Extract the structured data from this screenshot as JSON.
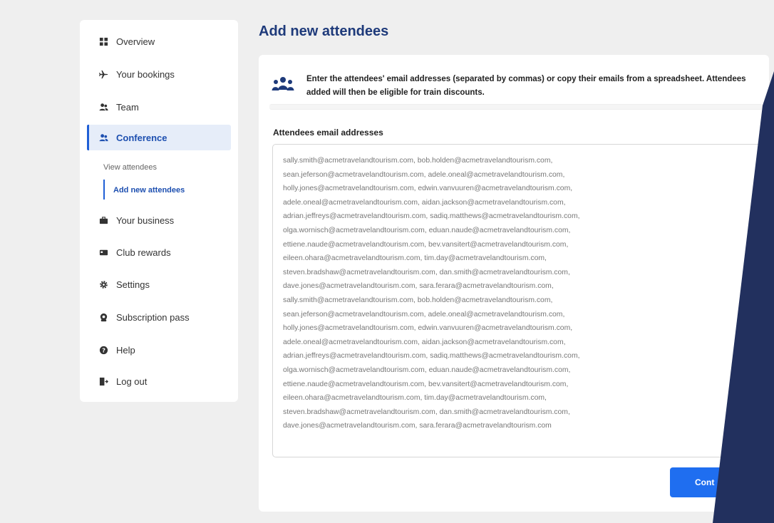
{
  "sidebar": {
    "items": [
      {
        "label": "Overview",
        "icon": "grid-icon"
      },
      {
        "label": "Your bookings",
        "icon": "plane-icon"
      },
      {
        "label": "Team",
        "icon": "people-icon"
      },
      {
        "label": "Conference",
        "icon": "people-icon",
        "active": true
      },
      {
        "label": "Your business",
        "icon": "briefcase-icon"
      },
      {
        "label": "Club rewards",
        "icon": "card-icon"
      },
      {
        "label": "Settings",
        "icon": "gear-icon"
      },
      {
        "label": "Subscription pass",
        "icon": "badge-icon"
      },
      {
        "label": "Help",
        "icon": "help-icon"
      },
      {
        "label": "Log out",
        "icon": "logout-icon"
      }
    ],
    "sub_items": [
      {
        "label": "View attendees"
      },
      {
        "label": "Add new attendees",
        "active": true
      }
    ]
  },
  "page": {
    "title": "Add new attendees",
    "info_text": "Enter the attendees' email addresses (separated by commas) or copy their emails from a spreadsheet. Attendees added will then be eligible for train discounts.",
    "field_label": "Attendees email addresses",
    "emails": [
      "sally.smith@acmetravelandtourism.com, bob.holden@acmetravelandtourism.com,",
      "sean.jeferson@acmetravelandtourism.com, adele.oneal@acmetravelandtourism.com,",
      "holly.jones@acmetravelandtourism.com, edwin.vanvuuren@acmetravelandtourism.com,",
      "adele.oneal@acmetravelandtourism.com, aidan.jackson@acmetravelandtourism.com,",
      "adrian.jeffreys@acmetravelandtourism.com, sadiq.matthews@acmetravelandtourism.com,",
      "olga.wornisch@acmetravelandtourism.com, eduan.naude@acmetravelandtourism.com,",
      "ettiene.naude@acmetravelandtourism.com, bev.vansitert@acmetravelandtourism.com,",
      "eileen.ohara@acmetravelandtourism.com, tim.day@acmetravelandtourism.com,",
      "steven.bradshaw@acmetravelandtourism.com, dan.smith@acmetravelandtourism.com,",
      "dave.jones@acmetravelandtourism.com, sara.ferara@acmetravelandtourism.com,",
      "sally.smith@acmetravelandtourism.com, bob.holden@acmetravelandtourism.com,",
      "sean.jeferson@acmetravelandtourism.com, adele.oneal@acmetravelandtourism.com,",
      "holly.jones@acmetravelandtourism.com, edwin.vanvuuren@acmetravelandtourism.com,",
      "adele.oneal@acmetravelandtourism.com, aidan.jackson@acmetravelandtourism.com,",
      "adrian.jeffreys@acmetravelandtourism.com, sadiq.matthews@acmetravelandtourism.com,",
      "olga.wornisch@acmetravelandtourism.com, eduan.naude@acmetravelandtourism.com,",
      "ettiene.naude@acmetravelandtourism.com, bev.vansitert@acmetravelandtourism.com,",
      "eileen.ohara@acmetravelandtourism.com, tim.day@acmetravelandtourism.com,",
      "steven.bradshaw@acmetravelandtourism.com, dan.smith@acmetravelandtourism.com,",
      "dave.jones@acmetravelandtourism.com, sara.ferara@acmetravelandtourism.com"
    ],
    "continue_label": "Cont"
  },
  "colors": {
    "accent": "#1f6ef0",
    "title": "#1e3a7a",
    "active_bg": "#e6edf9",
    "decor_navy": "#22305e"
  }
}
